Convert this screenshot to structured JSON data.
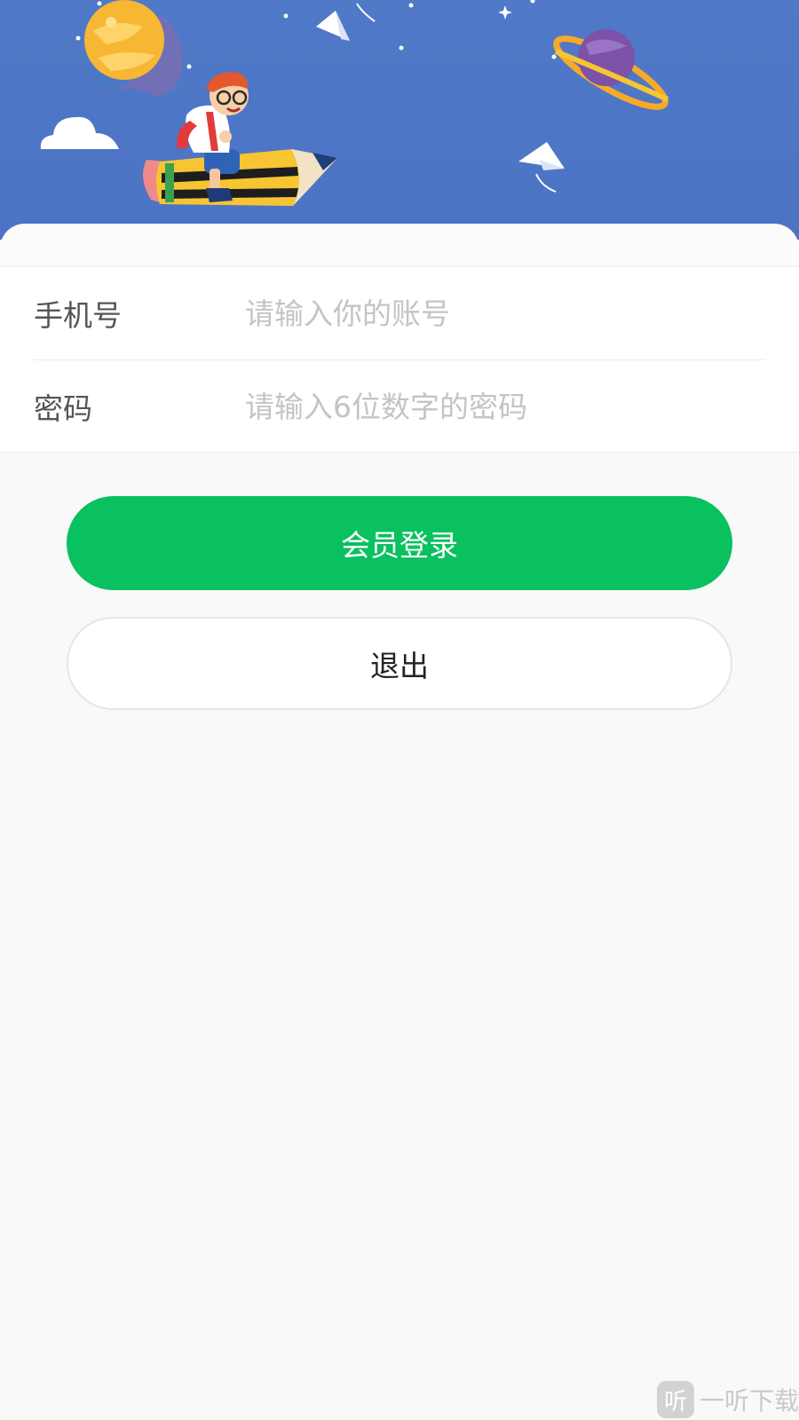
{
  "form": {
    "phone": {
      "label": "手机号",
      "placeholder": "请输入你的账号",
      "value": ""
    },
    "password": {
      "label": "密码",
      "placeholder": "请输入6位数字的密码",
      "value": ""
    }
  },
  "buttons": {
    "login": "会员登录",
    "exit": "退出"
  },
  "watermark": {
    "icon_char": "听",
    "text": "一听下载"
  },
  "colors": {
    "banner": "#4c73c4",
    "primary": "#09c15f"
  }
}
